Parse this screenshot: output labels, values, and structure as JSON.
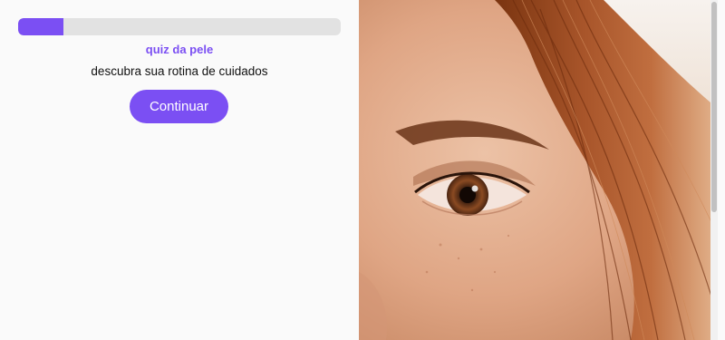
{
  "quiz": {
    "progress_fraction": 0.14,
    "title": "quiz da pele",
    "subtitle": "descubra sua rotina de cuidados",
    "continue_label": "Continuar"
  },
  "colors": {
    "accent": "#7b4ff3",
    "track": "#e2e2e2",
    "background": "#fafafa"
  },
  "hero_image": {
    "alt": "close-up of a woman's eye with auburn hair"
  }
}
